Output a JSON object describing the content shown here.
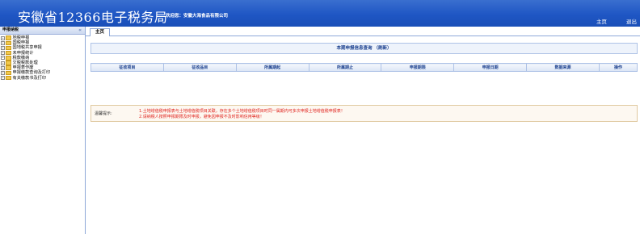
{
  "header": {
    "title": "安徽省12366电子税务局",
    "welcome": "欢迎您：安徽大海食品有限公司",
    "home_link": "主页",
    "logout_link": "退出"
  },
  "sidebar": {
    "title": "申报纳税",
    "items": [
      {
        "label": "地税申报"
      },
      {
        "label": "国税申报"
      },
      {
        "label": "国地税共享申报"
      },
      {
        "label": "未申报统计"
      },
      {
        "label": "税款缴纳"
      },
      {
        "label": "欠税税款处理"
      },
      {
        "label": "申报表作废"
      },
      {
        "label": "申报缴款查询及打印"
      },
      {
        "label": "有关缴款书及打印"
      }
    ]
  },
  "tabs": [
    {
      "label": "主页"
    }
  ],
  "query": {
    "title": "本期申报信息查询",
    "refresh": "（刷新）"
  },
  "table": {
    "columns": [
      "征收项目",
      "征收品目",
      "所属期起",
      "所属期止",
      "申报期限",
      "申报日期",
      "数据来源",
      "操作"
    ]
  },
  "tips": {
    "label": "温馨提示:",
    "line1": "1.土地增值税申报表与土地增值税项目关联，存在多个土地增值税项目时同一属期内可多次申报土地增值税申报表！",
    "line2": "2.请纳税人按照申报期限及时申报，避免因申报不及时影响信用等级！"
  }
}
